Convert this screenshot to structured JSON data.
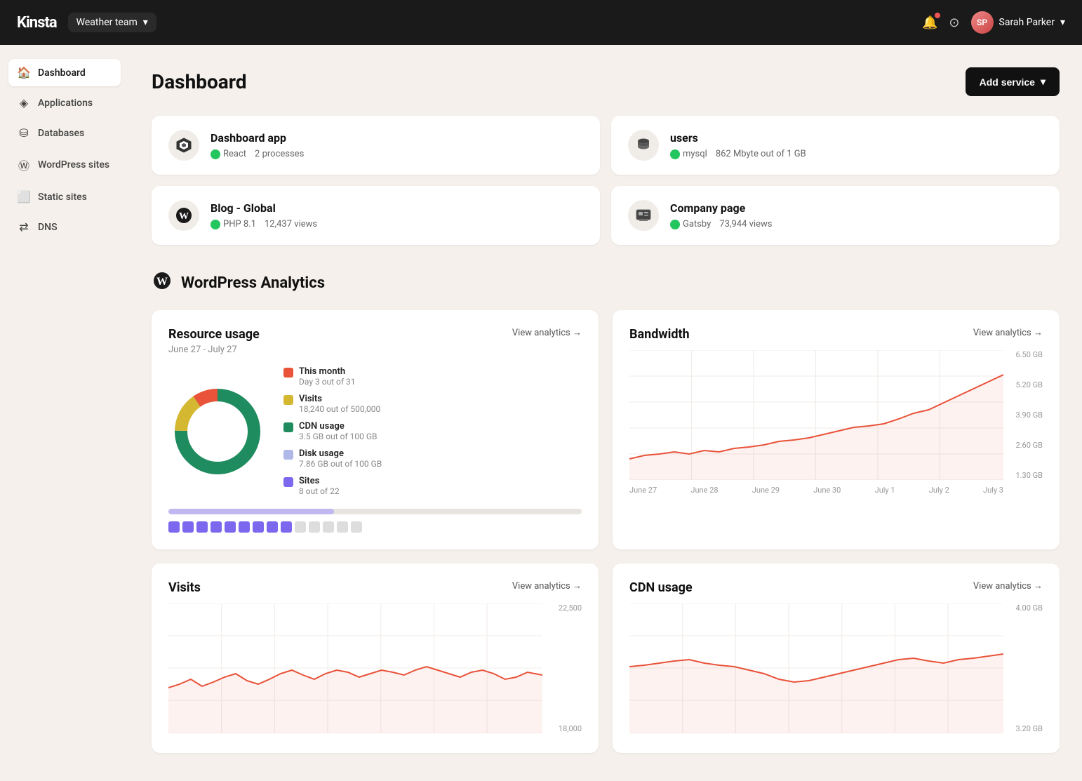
{
  "topnav": {
    "logo": "Kinsta",
    "team": "Weather team",
    "help_label": "?",
    "user_name": "Sarah Parker",
    "user_initials": "SP"
  },
  "sidebar": {
    "items": [
      {
        "id": "dashboard",
        "label": "Dashboard",
        "icon": "🏠",
        "active": true
      },
      {
        "id": "applications",
        "label": "Applications",
        "icon": "⬡",
        "active": false
      },
      {
        "id": "databases",
        "label": "Databases",
        "icon": "🗄",
        "active": false
      },
      {
        "id": "wordpress-sites",
        "label": "WordPress sites",
        "icon": "Ⓦ",
        "active": false
      },
      {
        "id": "static-sites",
        "label": "Static sites",
        "icon": "⬜",
        "active": false
      },
      {
        "id": "dns",
        "label": "DNS",
        "icon": "⇄",
        "active": false
      }
    ]
  },
  "page": {
    "title": "Dashboard",
    "add_service_label": "Add service"
  },
  "service_cards": [
    {
      "id": "dashboard-app",
      "name": "Dashboard app",
      "icon": "⬡",
      "status": "active",
      "tech": "React",
      "detail": "2 processes"
    },
    {
      "id": "users",
      "name": "users",
      "icon": "🗄",
      "status": "active",
      "tech": "mysql",
      "detail": "862 Mbyte out of 1 GB"
    },
    {
      "id": "blog-global",
      "name": "Blog - Global",
      "icon": "Ⓦ",
      "status": "active",
      "tech": "PHP 8.1",
      "detail": "12,437 views"
    },
    {
      "id": "company-page",
      "name": "Company page",
      "icon": "🖥",
      "status": "active",
      "tech": "Gatsby",
      "detail": "73,944 views"
    }
  ],
  "wp_analytics": {
    "section_title": "WordPress Analytics",
    "resource_usage": {
      "title": "Resource usage",
      "subtitle": "June 27 - July 27",
      "view_link": "View analytics →",
      "legend": [
        {
          "id": "this-month",
          "color": "#e8533a",
          "label": "This month",
          "sub": "Day 3 out of 31"
        },
        {
          "id": "visits",
          "color": "#d4b832",
          "label": "Visits",
          "sub": "18,240 out of 500,000"
        },
        {
          "id": "cdn-usage",
          "color": "#1e8c5e",
          "label": "CDN usage",
          "sub": "3.5 GB out of 100 GB"
        },
        {
          "id": "disk-usage",
          "color": "#b0b8e8",
          "label": "Disk usage",
          "sub": "7.86 GB out of 100 GB"
        },
        {
          "id": "sites",
          "color": "#7b68ee",
          "label": "Sites",
          "sub": "8 out of 22"
        }
      ],
      "donut": {
        "segments": [
          {
            "color": "#1e8c5e",
            "pct": 75
          },
          {
            "color": "#d4b832",
            "pct": 15
          },
          {
            "color": "#e8533a",
            "pct": 10
          }
        ]
      },
      "progress_pct": 40,
      "squares_filled": 9,
      "squares_total": 14
    },
    "bandwidth": {
      "title": "Bandwidth",
      "view_link": "View analytics →",
      "x_labels": [
        "June 27",
        "June 28",
        "June 29",
        "June 30",
        "July 1",
        "July 2",
        "July 3"
      ],
      "y_labels": [
        "6.50 GB",
        "5.20 GB",
        "3.90 GB",
        "2.60 GB",
        "1.30 GB"
      ]
    },
    "visits": {
      "title": "Visits",
      "view_link": "View analytics →",
      "y_labels": [
        "22,500",
        "18,000"
      ]
    },
    "cdn_usage": {
      "title": "CDN usage",
      "view_link": "View analytics →",
      "y_labels": [
        "4.00 GB",
        "3.20 GB"
      ]
    }
  }
}
